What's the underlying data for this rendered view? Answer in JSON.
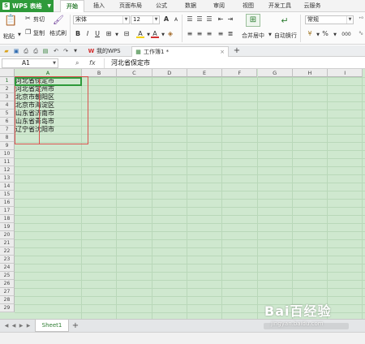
{
  "menubar": {
    "app_logo": "S",
    "app_name": "WPS 表格",
    "tabs": [
      "开始",
      "插入",
      "页面布局",
      "公式",
      "数据",
      "审阅",
      "视图",
      "开发工具",
      "云服务"
    ],
    "active_tab": "开始"
  },
  "ribbon": {
    "cut": "剪切",
    "paste": "粘贴",
    "copy": "复制",
    "format_painter": "格式刷",
    "font_name": "宋体",
    "font_size": "12",
    "merge_center": "合并居中",
    "wrap_text": "自动换行",
    "number_format": "常规",
    "bold": "B",
    "italic": "I",
    "underline": "U",
    "grow_font": "A",
    "shrink_font": "A",
    "fill_color": "A",
    "font_color": "A",
    "percent": "%",
    "thousands": "000"
  },
  "doc_tabs": [
    {
      "label": "我的WPS",
      "icon": "wps-icon"
    },
    {
      "label": "工作簿1 *",
      "icon": "workbook-icon"
    }
  ],
  "formula_bar": {
    "name_box": "A1",
    "fx_label": "fx",
    "formula": "河北省保定市"
  },
  "columns": [
    "A",
    "B",
    "C",
    "D",
    "E",
    "F",
    "G",
    "H",
    "I"
  ],
  "rows": [
    "1",
    "2",
    "3",
    "4",
    "5",
    "6",
    "7",
    "8",
    "9",
    "10",
    "11",
    "12",
    "13",
    "14",
    "15",
    "16",
    "17",
    "18",
    "19",
    "20",
    "21",
    "22",
    "23",
    "24",
    "25",
    "26",
    "27",
    "28",
    "29"
  ],
  "cells": [
    "河北省保定市",
    "河北省定州市",
    "北京市朝阳区",
    "北京市海淀区",
    "山东省济南市",
    "山东省青岛市",
    "辽宁省沈阳市"
  ],
  "sheet_tabs": [
    "Sheet1"
  ],
  "add_sheet": "+",
  "watermark": {
    "brand": "Bai百经验",
    "url": "jingyan.baidu.com"
  },
  "colors": {
    "accent": "#2e9a3a",
    "grid_bg": "#cfe8cf",
    "annotation": "#d9534f"
  }
}
